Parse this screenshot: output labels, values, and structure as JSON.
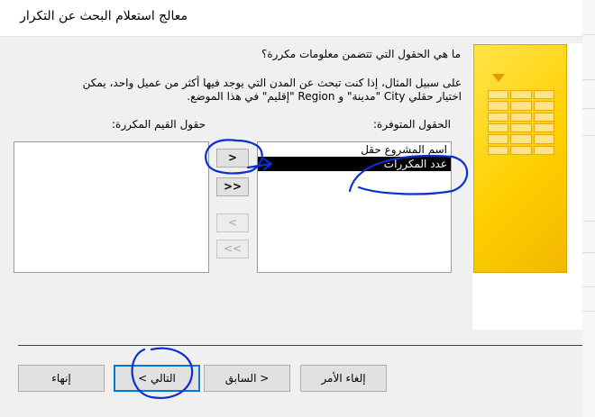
{
  "window": {
    "title": "معالج استعلام البحث عن التكرار"
  },
  "prompt": {
    "question": "ما هي الحقول التي تتضمن معلومات مكررة؟",
    "example_line1": "على سبيل المثال، إذا كنت تبحث عن المدن التي يوجد فيها أكثر من عميل واحد، يمكن",
    "example_line2": "اختيار حقلي City \"مدينة\" و Region \"إقليم\" في هذا الموضع."
  },
  "available_fields": {
    "label": "الحقول المتوفرة:",
    "items": [
      {
        "label": "اسم المشروع حقل",
        "selected": false
      },
      {
        "label": "عدد المكررات",
        "selected": true
      }
    ]
  },
  "duplicate_fields": {
    "label": "حقول القيم المكررة:",
    "items": []
  },
  "move_buttons": {
    "add_one": ">",
    "add_all": ">>",
    "remove_one": "<",
    "remove_all": "<<"
  },
  "footer": {
    "cancel": "إلغاء الأمر",
    "back": "< السابق",
    "next": "التالي >",
    "finish": "إنهاء"
  },
  "colors": {
    "accent": "#0078d7",
    "annotation_ink": "#0b2fd0",
    "art_yellow": "#ffd000"
  }
}
